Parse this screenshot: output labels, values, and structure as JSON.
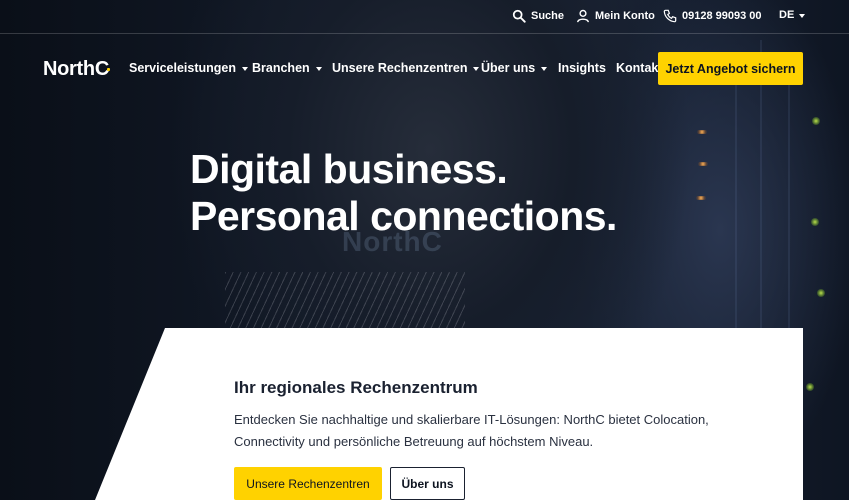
{
  "topbar": {
    "search_label": "Suche",
    "account_label": "Mein Konto",
    "phone_label": "09128 99093 00",
    "lang_label": "DE"
  },
  "nav": {
    "logo_text": "North",
    "logo_c": "C",
    "items": [
      {
        "label": "Serviceleistungen",
        "has_dropdown": true
      },
      {
        "label": "Branchen",
        "has_dropdown": true
      },
      {
        "label": "Unsere Rechenzentren",
        "has_dropdown": true
      },
      {
        "label": "Über uns",
        "has_dropdown": true
      },
      {
        "label": "Insights",
        "has_dropdown": false
      },
      {
        "label": "Kontakt",
        "has_dropdown": false
      }
    ],
    "cta_label": "Jetzt Angebot sichern"
  },
  "hero": {
    "headline_line1": "Digital business.",
    "headline_line2": "Personal connections.",
    "shirt_logo": "NorthC"
  },
  "card": {
    "title": "Ihr regionales Rechenzentrum",
    "text": "Entdecken Sie nachhaltige und skalierbare IT-Lösungen: NorthC bietet Colocation, Connectivity und persönliche Betreuung auf höchstem Niveau.",
    "primary_button": "Unsere Rechenzentren",
    "secondary_button": "Über uns"
  },
  "colors": {
    "accent": "#ffd200",
    "dark": "#0d1420",
    "text_dark": "#1a2130"
  },
  "icons": {
    "search": "search-icon",
    "account": "user-icon",
    "phone": "phone-icon",
    "caret": "chevron-down-icon"
  }
}
